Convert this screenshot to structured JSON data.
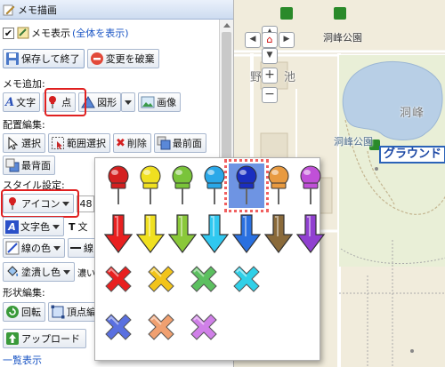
{
  "panel": {
    "title": "メモ描画",
    "memo_display": {
      "label": "メモ表示",
      "link": "(全体を表示)",
      "checked": true
    },
    "save_button": "保存して終了",
    "discard_button": "変更を破棄",
    "memo_add": {
      "heading": "メモ追加:",
      "text_button": "文字",
      "point_button": "点",
      "shape_button": "図形",
      "image_button": "画像"
    },
    "layout_edit": {
      "heading": "配置編集:",
      "select_button": "選択",
      "range_select_button": "範囲選択",
      "delete_button": "削除",
      "front_button": "最前面",
      "back_button": "最背面"
    },
    "style": {
      "heading": "スタイル設定:",
      "icon_dropdown": "アイコン",
      "size_value": "48",
      "text_color_button": "文字色",
      "text_t_label": "T",
      "text_t_suffix": "文",
      "line_color_button": "線の色",
      "line_width_button": "線",
      "fill_color_button": "塗潰し色",
      "fill_suffix": "濃い"
    },
    "shape_edit": {
      "heading": "形状編集:",
      "rotate_button": "回転",
      "vertex_button": "頂点編"
    },
    "upload_button": "アップロード",
    "footer_link": "一覧表示"
  },
  "map": {
    "labels": {
      "park_top": "洞峰公園",
      "nobeyama": "野",
      "pond_label": "池",
      "lake_side": "洞峰",
      "lake": "洞峰沼",
      "park_mid": "洞峰公園",
      "callout": "グラウンド"
    },
    "zoom_in": "+",
    "zoom_out": "−",
    "colors": {
      "background": "#f1ecdc",
      "water": "#b8cfe6",
      "road": "#ffffff",
      "accent": "#1b47a4"
    }
  },
  "icon_picker": {
    "pins": [
      {
        "name": "red-pin-icon",
        "color": "#d42020"
      },
      {
        "name": "yellow-pin-icon",
        "color": "#f0e020"
      },
      {
        "name": "green-pin-icon",
        "color": "#7ac43a"
      },
      {
        "name": "cyan-pin-icon",
        "color": "#2aa8e8"
      },
      {
        "name": "blue-pin-icon",
        "color": "#1a2ec0",
        "selected": true
      },
      {
        "name": "orange-pin-icon",
        "color": "#e89a40"
      },
      {
        "name": "purple-pin-icon",
        "color": "#c050d8"
      }
    ],
    "arrows": [
      {
        "name": "red-arrow-icon",
        "color": "#e82020"
      },
      {
        "name": "yellow-arrow-icon",
        "color": "#f0e020"
      },
      {
        "name": "green-arrow-icon",
        "color": "#8ac83a"
      },
      {
        "name": "cyan-arrow-icon",
        "color": "#30c8f0"
      },
      {
        "name": "blue-arrow-icon",
        "color": "#2a70e0"
      },
      {
        "name": "brown-arrow-icon",
        "color": "#8a6a3a"
      },
      {
        "name": "purple-arrow-icon",
        "color": "#9040d0"
      }
    ],
    "crosses": [
      {
        "name": "red-cross-icon",
        "color": "#e82020"
      },
      {
        "name": "yellow-cross-icon",
        "color": "#f2c41a"
      },
      {
        "name": "green-cross-icon",
        "color": "#5cc060"
      },
      {
        "name": "cyan-cross-icon",
        "color": "#30d0e8"
      },
      {
        "name": "blue-cross-icon",
        "color": "#5a70e0"
      },
      {
        "name": "orange-cross-icon",
        "color": "#f0a070"
      },
      {
        "name": "violet-cross-icon",
        "color": "#d080e8"
      }
    ]
  }
}
